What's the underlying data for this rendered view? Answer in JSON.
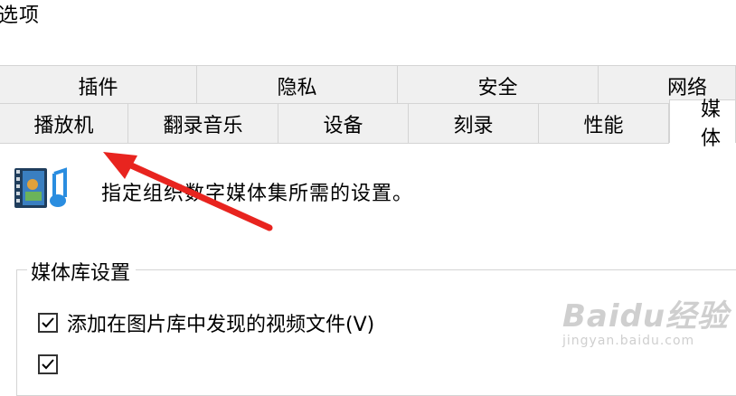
{
  "window": {
    "title": "选项"
  },
  "tabs_row1": [
    {
      "label": "插件"
    },
    {
      "label": "隐私"
    },
    {
      "label": "安全"
    },
    {
      "label": "网络"
    }
  ],
  "tabs_row2": [
    {
      "label": "播放机"
    },
    {
      "label": "翻录音乐"
    },
    {
      "label": "设备"
    },
    {
      "label": "刻录"
    },
    {
      "label": "性能"
    },
    {
      "label": "媒体"
    }
  ],
  "content": {
    "icon": "media-library-film-music-icon",
    "description": "指定组织数字媒体集所需的设置。",
    "group_title": "媒体库设置",
    "checkboxes": [
      {
        "label": "添加在图片库中发现的视频文件(V)",
        "checked": true
      },
      {
        "label": "",
        "checked": true
      }
    ]
  },
  "overlay": {
    "arrow_color": "#e8241f",
    "arrow_icon": "red-arrow-annotation"
  },
  "watermark": {
    "logo": "Baidu经验",
    "url": "jingyan.baidu.com"
  },
  "colors": {
    "tab_bg": "#f0f0f0",
    "border": "#d4d4d4",
    "accent": "#e8241f"
  }
}
